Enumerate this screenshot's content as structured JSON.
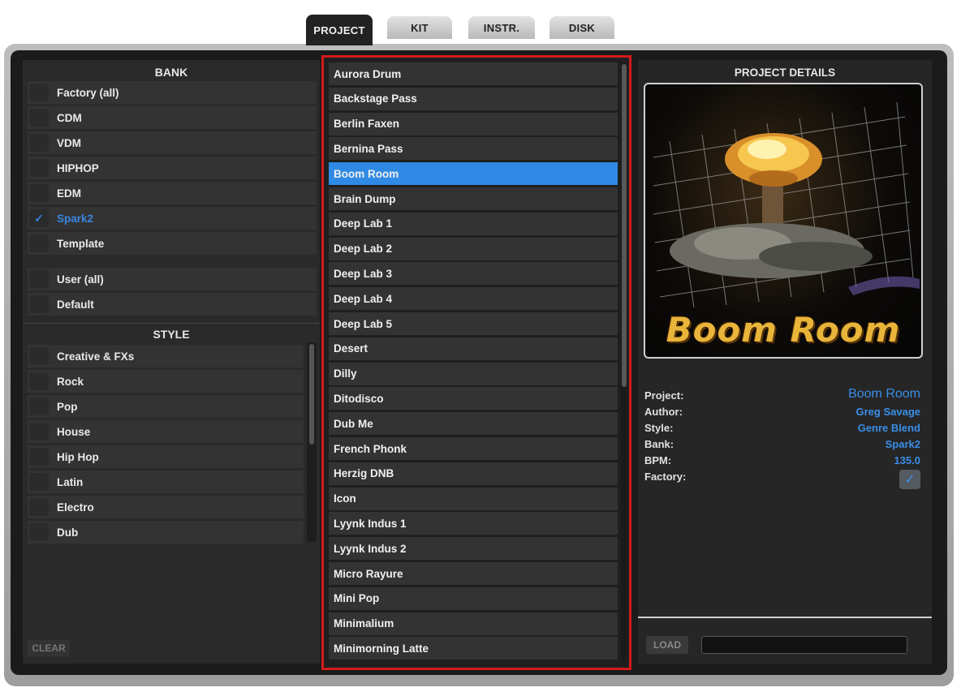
{
  "tabs": [
    {
      "label": "PROJECT",
      "active": true
    },
    {
      "label": "KIT",
      "active": false
    },
    {
      "label": "INSTR.",
      "active": false
    },
    {
      "label": "DISK",
      "active": false
    }
  ],
  "bank": {
    "header": "BANK",
    "items": [
      {
        "label": "Factory (all)",
        "checked": false
      },
      {
        "label": "CDM",
        "checked": false
      },
      {
        "label": "VDM",
        "checked": false
      },
      {
        "label": "HIPHOP",
        "checked": false
      },
      {
        "label": "EDM",
        "checked": false
      },
      {
        "label": "Spark2",
        "checked": true
      },
      {
        "label": "Template",
        "checked": false
      },
      {
        "label": "User (all)",
        "checked": false
      },
      {
        "label": "Default",
        "checked": false
      }
    ]
  },
  "style": {
    "header": "STYLE",
    "items": [
      "Creative & FXs",
      "Rock",
      "Pop",
      "House",
      "Hip Hop",
      "Latin",
      "Electro",
      "Dub"
    ]
  },
  "clear_label": "CLEAR",
  "projects": {
    "selected": "Boom Room",
    "items": [
      "Aurora Drum",
      "Backstage Pass",
      "Berlin Faxen",
      "Bernina Pass",
      "Boom Room",
      "Brain Dump",
      "Deep Lab 1",
      "Deep Lab 2",
      "Deep Lab 3",
      "Deep Lab 4",
      "Deep Lab 5",
      "Desert",
      "Dilly",
      "Ditodisco",
      "Dub Me",
      "French Phonk",
      "Herzig DNB",
      "Icon",
      "Lyynk Indus 1",
      "Lyynk Indus 2",
      "Micro Rayure",
      "Mini Pop",
      "Minimalium",
      "Minimorning Latte"
    ]
  },
  "details": {
    "title": "PROJECT DETAILS",
    "art_title": "Boom Room",
    "project_label": "Project:",
    "project_value": "Boom Room",
    "author_label": "Author:",
    "author_value": "Greg Savage",
    "style_label": "Style:",
    "style_value": "Genre Blend",
    "bank_label": "Bank:",
    "bank_value": "Spark2",
    "bpm_label": "BPM:",
    "bpm_value": "135.0",
    "factory_label": "Factory:",
    "factory_checked": true
  },
  "load_label": "LOAD",
  "load_progress": 0.0,
  "colors": {
    "accent": "#2f8ae6",
    "highlight_border": "#d41a1a",
    "panel": "#2a2a2a",
    "row": "#333333"
  }
}
